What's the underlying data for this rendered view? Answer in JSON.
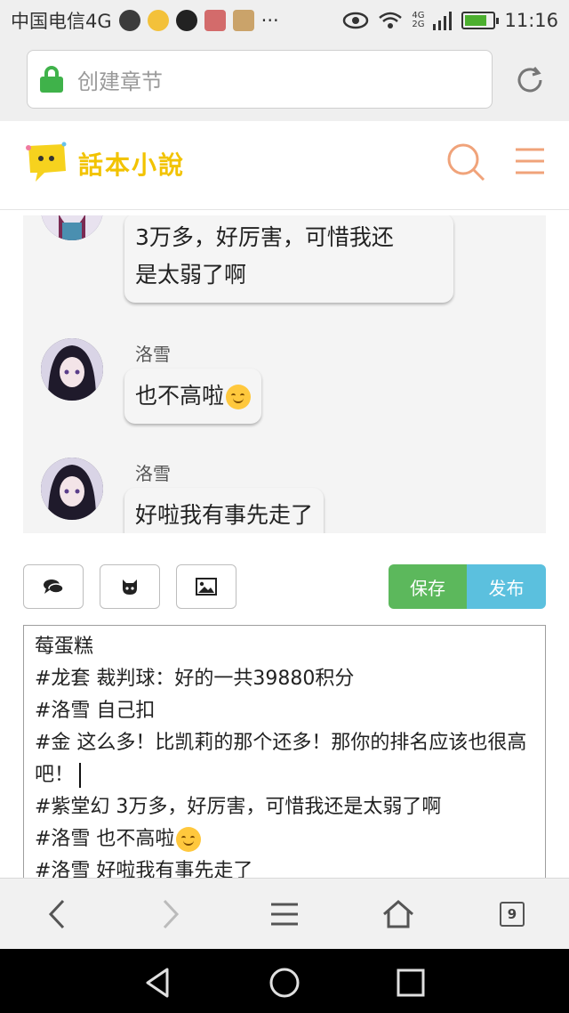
{
  "status_bar": {
    "carrier": "中国电信4G",
    "more": "···",
    "network_top": "4G",
    "network_bottom": "2G",
    "time": "11:16",
    "battery_level": 0.8,
    "icons": [
      "app-icon-1",
      "app-icon-2",
      "qq-icon",
      "app-icon-3",
      "gallery-icon",
      "eye-icon",
      "wifi-icon",
      "signal-icon",
      "battery-icon"
    ]
  },
  "url_bar": {
    "text": "创建章节"
  },
  "site": {
    "name": "話本小說"
  },
  "chat": {
    "messages": [
      {
        "text": "3万多，好厉害，可惜我还是太弱了啊",
        "line1": "3万多，好厉害，可惜我还",
        "line2": "是太弱了啊"
      },
      {
        "sender": "洛雪",
        "text": "也不高啦"
      },
      {
        "sender": "洛雪",
        "text": "好啦我有事先走了"
      }
    ]
  },
  "toolbar": {
    "save_label": "保存",
    "publish_label": "发布",
    "tools": [
      "chat-icon",
      "github-icon",
      "image-icon"
    ]
  },
  "editor": {
    "lines": [
      "莓蛋糕",
      "#龙套 裁判球：好的一共39880积分",
      "#洛雪 自己扣",
      "#金 这么多！比凯莉的那个还多！那你的排名应该也很高吧！",
      "#紫堂幻 3万多，好厉害，可惜我还是太弱了啊",
      "#洛雪 也不高啦",
      "#洛雪 好啦我有事先走了"
    ]
  },
  "browser_bar": {
    "tab_count": "9"
  },
  "colors": {
    "save": "#5cb85c",
    "publish": "#5bc0de",
    "accent": "#f0a37a",
    "secure": "#3fb24a"
  }
}
